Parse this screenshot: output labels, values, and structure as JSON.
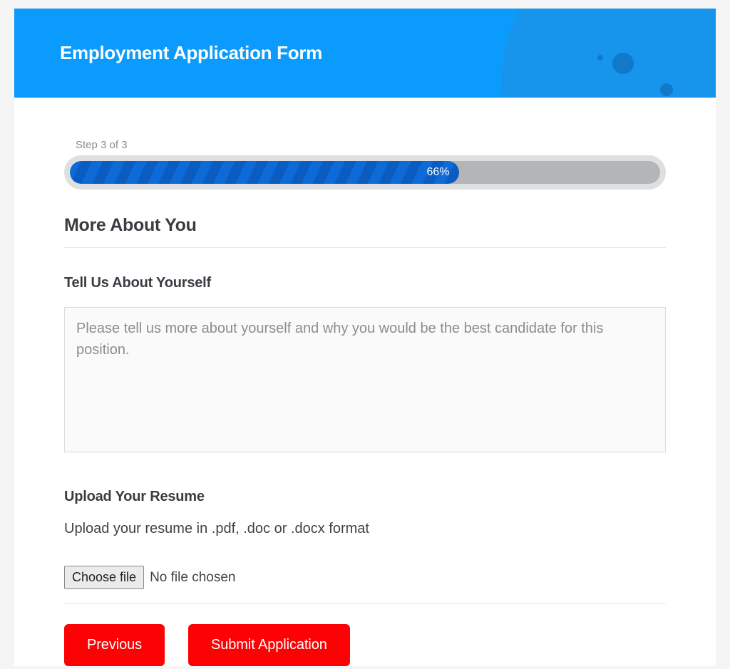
{
  "header": {
    "title": "Employment Application Form"
  },
  "progress": {
    "step_label": "Step 3 of 3",
    "percent_label": "66%",
    "percent_width": "66%"
  },
  "section": {
    "title": "More About You"
  },
  "about": {
    "label": "Tell Us About Yourself",
    "placeholder": "Please tell us more about yourself and why you would be the best candidate for this position."
  },
  "resume": {
    "label": "Upload Your Resume",
    "help": "Upload your resume in .pdf, .doc or .docx format",
    "choose_label": "Choose file",
    "status": "No file chosen"
  },
  "buttons": {
    "previous": "Previous",
    "submit": "Submit Application"
  }
}
